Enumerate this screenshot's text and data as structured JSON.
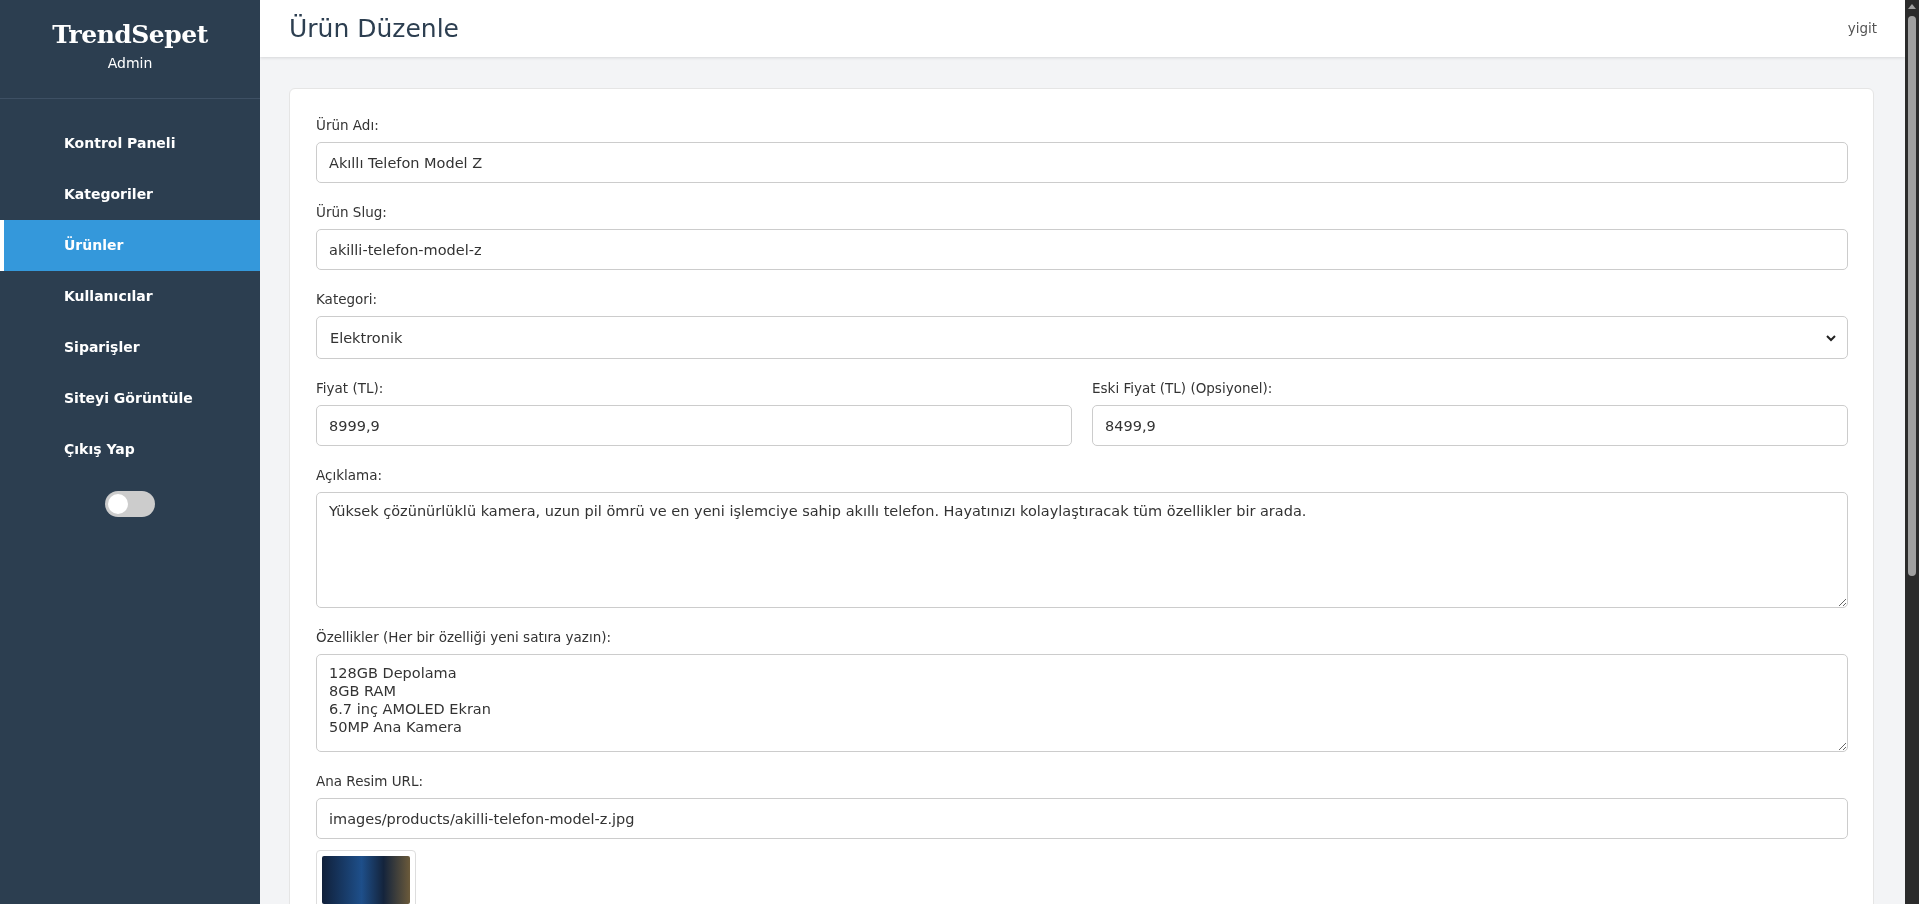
{
  "sidebar": {
    "brand": "TrendSepet",
    "subtitle": "Admin",
    "items": [
      {
        "label": "Kontrol Paneli",
        "selected": false
      },
      {
        "label": "Kategoriler",
        "selected": false
      },
      {
        "label": "Ürünler",
        "selected": true
      },
      {
        "label": "Kullanıcılar",
        "selected": false
      },
      {
        "label": "Siparişler",
        "selected": false
      },
      {
        "label": "Siteyi Görüntüle",
        "selected": false
      },
      {
        "label": "Çıkış Yap",
        "selected": false
      }
    ],
    "theme_toggle": {
      "on": false
    }
  },
  "header": {
    "title": "Ürün Düzenle",
    "user": "yigit"
  },
  "form": {
    "rows": [
      [
        {
          "kind": "text",
          "label": "Ürün Adı:",
          "value": "Akıllı Telefon Model Z"
        }
      ],
      [
        {
          "kind": "text",
          "label": "Ürün Slug:",
          "value": "akilli-telefon-model-z"
        }
      ],
      [
        {
          "kind": "select",
          "label": "Kategori:",
          "value": "Elektronik"
        }
      ],
      [
        {
          "kind": "text",
          "label": "Fiyat (TL):",
          "value": "8999,9"
        },
        {
          "kind": "text",
          "label": "Eski Fiyat (TL) (Opsiyonel):",
          "value": "8499,9"
        }
      ],
      [
        {
          "kind": "textarea",
          "label": "Açıklama:",
          "value": "Yüksek çözünürlüklü kamera, uzun pil ömrü ve en yeni işlemciye sahip akıllı telefon. Hayatınızı kolaylaştıracak tüm özellikler bir arada."
        }
      ],
      [
        {
          "kind": "list",
          "label": "Özellikler (Her bir özelliği yeni satıra yazın):",
          "lines": [
            "128GB Depolama",
            "8GB RAM",
            "6.7 inç AMOLED Ekran",
            "50MP Ana Kamera"
          ]
        }
      ],
      [
        {
          "kind": "text",
          "label": "Ana Resim URL:",
          "value": "images/products/akilli-telefon-model-z.jpg"
        }
      ]
    ]
  }
}
